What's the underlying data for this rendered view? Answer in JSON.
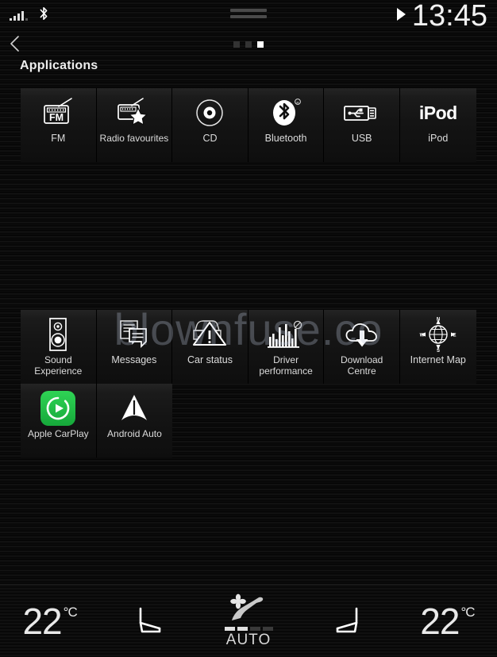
{
  "status_bar": {
    "signal_icon": "cellular-signal-icon",
    "signal_bars": 4,
    "bluetooth_icon": "bluetooth-icon",
    "grab_handle_icon": "drag-handle-icon",
    "media_play_icon": "play-icon",
    "clock": "13:45"
  },
  "nav": {
    "back_icon": "chevron-left-icon",
    "page_dots": 3,
    "active_page": 3
  },
  "header": {
    "title": "Applications"
  },
  "app_rows": [
    {
      "row": 1,
      "tiles": [
        {
          "label": "FM",
          "icon": "fm-radio-icon"
        },
        {
          "label": "Radio favourites",
          "icon": "radio-star-icon"
        },
        {
          "label": "CD",
          "icon": "cd-disc-icon"
        },
        {
          "label": "Bluetooth",
          "icon": "bluetooth-icon"
        },
        {
          "label": "USB",
          "icon": "usb-plug-icon"
        },
        {
          "label": "iPod",
          "icon": "ipod-text-icon"
        }
      ]
    },
    {
      "row": 2,
      "tiles": [
        {
          "label": "Sound Experience",
          "icon": "speaker-icon"
        },
        {
          "label": "Messages",
          "icon": "messages-icon"
        },
        {
          "label": "Car status",
          "icon": "car-warning-triangle-icon"
        },
        {
          "label": "Driver performance",
          "icon": "bar-chart-icon"
        },
        {
          "label": "Download Centre",
          "icon": "cloud-download-icon"
        },
        {
          "label": "Internet Map",
          "icon": "globe-compass-icon"
        }
      ]
    },
    {
      "row": 3,
      "tiles": [
        {
          "label": "Apple CarPlay",
          "icon": "apple-carplay-icon"
        },
        {
          "label": "Android Auto",
          "icon": "android-auto-icon"
        }
      ]
    }
  ],
  "watermark": {
    "text": "blownfuse.co"
  },
  "climate": {
    "left_temperature": "22",
    "left_unit": "°C",
    "left_seat_icon": "seat-heat-left-icon",
    "center_icon": "climate-auto-airflow-icon",
    "center_label": "AUTO",
    "fan_level": 2,
    "fan_steps": 4,
    "right_seat_icon": "seat-heat-right-icon",
    "right_temperature": "22",
    "right_unit": "°C"
  },
  "colors": {
    "background": "#000000",
    "tile_gradient_top": "#242424",
    "tile_gradient_bottom": "#0e0e0e",
    "text": "#e8e8e8",
    "carplay_green": "#2fd455",
    "accent_white": "#ffffff"
  }
}
